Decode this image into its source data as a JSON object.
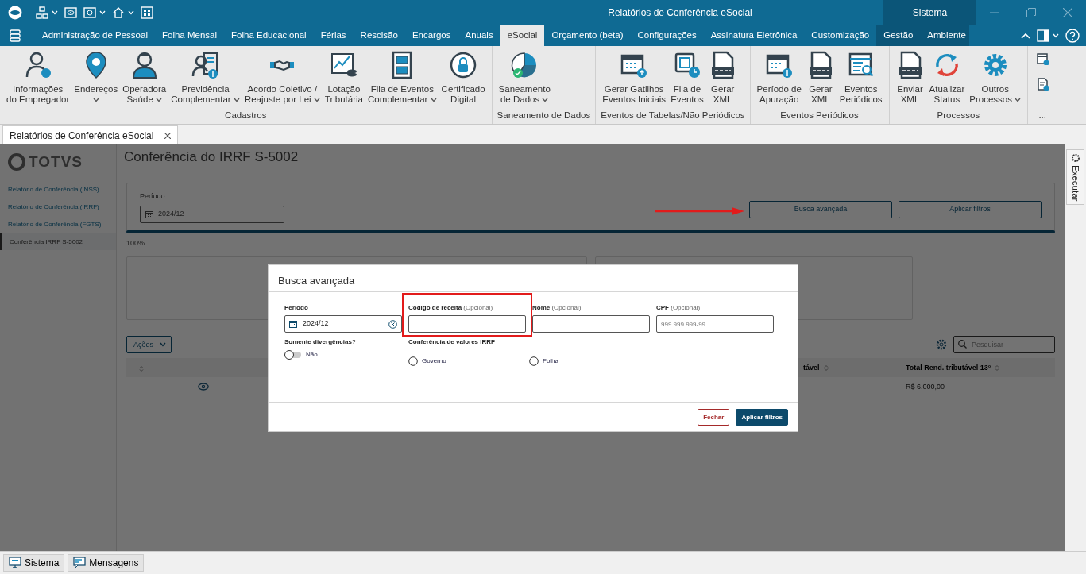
{
  "window": {
    "title": "Relatórios de Conferência eSocial",
    "account_area": "Sistema"
  },
  "menu_tabs": [
    {
      "label": "Administração de Pessoal",
      "selected": false
    },
    {
      "label": "Folha Mensal",
      "selected": false
    },
    {
      "label": "Folha Educacional",
      "selected": false
    },
    {
      "label": "Férias",
      "selected": false
    },
    {
      "label": "Rescisão",
      "selected": false
    },
    {
      "label": "Encargos",
      "selected": false
    },
    {
      "label": "Anuais",
      "selected": false
    },
    {
      "label": "eSocial",
      "selected": true
    },
    {
      "label": "Orçamento (beta)",
      "selected": false
    },
    {
      "label": "Configurações",
      "selected": false
    },
    {
      "label": "Assinatura Eletrônica",
      "selected": false
    },
    {
      "label": "Customização",
      "selected": false
    }
  ],
  "context_tabs": [
    {
      "label": "Gestão",
      "selected": false
    },
    {
      "label": "Ambiente",
      "selected": false
    }
  ],
  "ribbon": {
    "groups": [
      {
        "label": "Cadastros",
        "items": [
          {
            "kind": "person",
            "label": "Informações\ndo Empregador",
            "dropdown": false
          },
          {
            "kind": "pin",
            "label": "Endereços",
            "dropdown": true
          },
          {
            "kind": "doctor",
            "label": "Operadora\nSaúde",
            "dropdown": true
          },
          {
            "kind": "person-dollar",
            "label": "Previdência\nComplementar",
            "dropdown": true
          },
          {
            "kind": "handshake",
            "label": "Acordo Coletivo /\nReajuste por Lei",
            "dropdown": true
          },
          {
            "kind": "chart",
            "label": "Lotação\nTributária",
            "dropdown": false
          },
          {
            "kind": "cabinet",
            "label": "Fila de Eventos\nComplementar",
            "dropdown": true
          },
          {
            "kind": "lock",
            "label": "Certificado\nDigital",
            "dropdown": false
          }
        ]
      },
      {
        "label": "Saneamento de Dados",
        "items": [
          {
            "kind": "pie",
            "label": "Saneamento\nde Dados",
            "dropdown": true
          }
        ]
      },
      {
        "label": "Eventos de Tabelas/Não Periódicos",
        "items": [
          {
            "kind": "calendar-upload",
            "label": "Gerar Gatilhos\nEventos Iniciais",
            "dropdown": false
          },
          {
            "kind": "doc-clock",
            "label": "Fila de\nEventos",
            "dropdown": false
          },
          {
            "kind": "xml",
            "label": "Gerar\nXML",
            "dropdown": false
          }
        ]
      },
      {
        "label": "Eventos Periódicos",
        "items": [
          {
            "kind": "calendar-dollar",
            "label": "Período de\nApuração",
            "dropdown": false
          },
          {
            "kind": "xml",
            "label": "Gerar\nXML",
            "dropdown": false
          },
          {
            "kind": "doc-search",
            "label": "Eventos\nPeriódicos",
            "dropdown": false
          }
        ]
      },
      {
        "label": "Processos",
        "items": [
          {
            "kind": "xml",
            "label": "Enviar\nXML",
            "dropdown": false
          },
          {
            "kind": "sync",
            "label": "Atualizar\nStatus",
            "dropdown": false
          },
          {
            "kind": "gear",
            "label": "Outros\nProcessos",
            "dropdown": true
          }
        ]
      },
      {
        "label": "...",
        "items": [
          {
            "kind": "small-list"
          },
          {
            "kind": "small-doc"
          }
        ]
      }
    ]
  },
  "document_tabs": [
    {
      "label": "Relatórios de Conferência eSocial",
      "selected": true
    }
  ],
  "page": {
    "logo": "TOTVS",
    "nav": [
      {
        "label": "Relatório de Conferência (INSS)",
        "selected": false
      },
      {
        "label": "Relatório de Conferência (IRRF)",
        "selected": false
      },
      {
        "label": "Relatório de Conferência (FGTS)",
        "selected": false
      },
      {
        "label": "Conferência IRRF S-5002",
        "selected": true
      }
    ],
    "heading": "Conferência do IRRF S-5002",
    "filter": {
      "period_label": "Período",
      "period_value": "2024/12",
      "buttons": [
        {
          "label": "Busca avançada",
          "pointed": true
        },
        {
          "label": "Aplicar filtros",
          "pointed": false
        }
      ]
    },
    "progress": {
      "level": 1,
      "reading": "100%"
    },
    "actions_button": "Ações",
    "search": {
      "placeholder": "Pesquisar"
    },
    "table": {
      "columns": [
        {
          "label": "tável"
        },
        {
          "label": "Total Rend. tributável 13°"
        }
      ],
      "rows": [
        {
          "value": "R$ 6.000,00"
        }
      ]
    }
  },
  "modal": {
    "title": "Busca avançada",
    "fields": [
      {
        "kind": "date",
        "label": "Período",
        "value": "2024/12",
        "highlighted": false
      },
      {
        "kind": "text",
        "label": "Código de receita",
        "hint": "(Opcional)",
        "highlighted": true
      },
      {
        "kind": "text",
        "label": "Nome",
        "hint": "(Opcional)",
        "highlighted": false
      },
      {
        "kind": "text",
        "label": "CPF",
        "hint": "(Opcional)",
        "placeholder": "999.999.999-99",
        "highlighted": false
      }
    ],
    "toggle": {
      "label": "Somente divergências?",
      "on": false,
      "text": "Não"
    },
    "radio_group": {
      "label": "Conferência de valores IRRF",
      "options": [
        {
          "label": "Governo",
          "selected": false
        },
        {
          "label": "Folha",
          "selected": false
        }
      ]
    },
    "buttons": [
      {
        "kind": "secondary",
        "label": "Fechar"
      },
      {
        "kind": "primary",
        "label": "Aplicar filtros"
      }
    ]
  },
  "side_panel": {
    "label": "Executar"
  },
  "status_bar": [
    {
      "kind": "system",
      "label": "Sistema"
    },
    {
      "kind": "messages",
      "label": "Mensagens"
    }
  ]
}
